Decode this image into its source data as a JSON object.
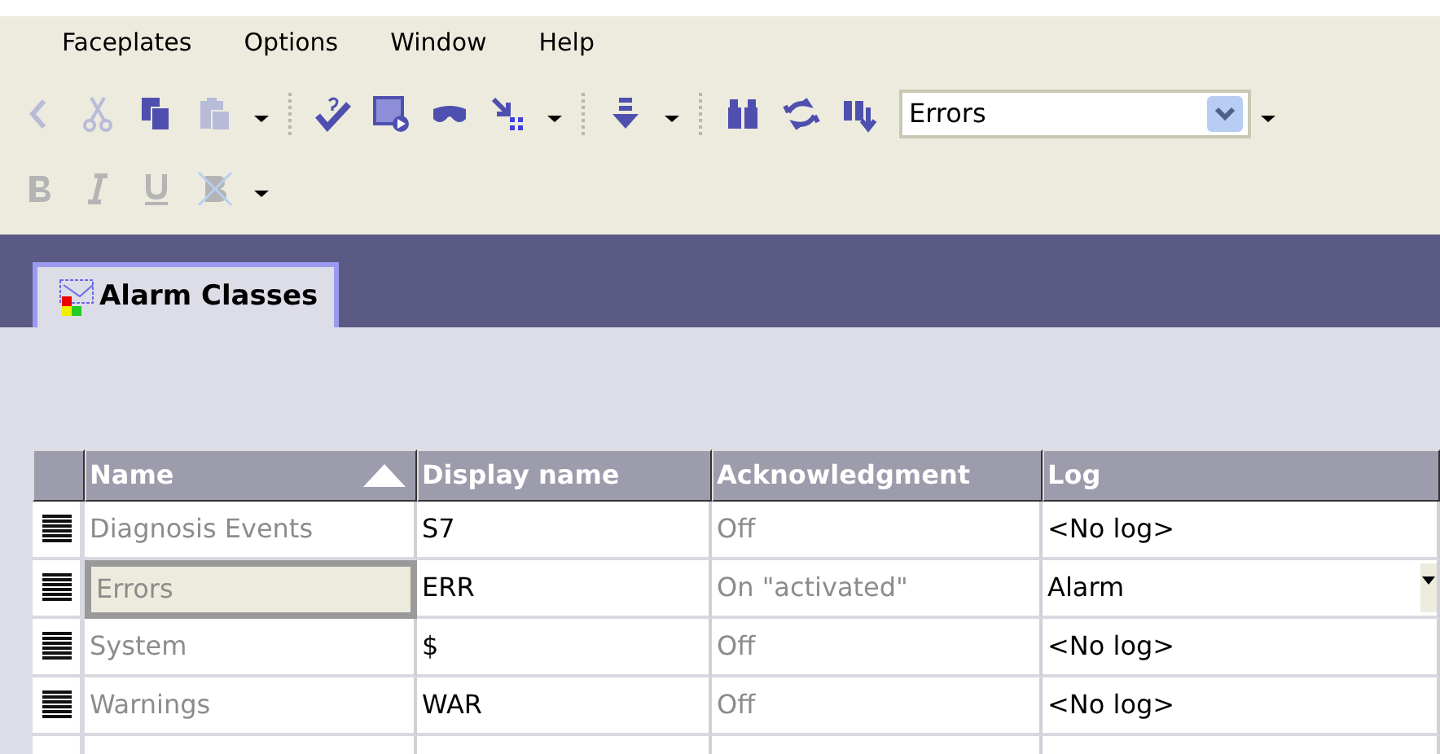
{
  "menu": [
    {
      "label": "Faceplates"
    },
    {
      "label": "Options"
    },
    {
      "label": "Window"
    },
    {
      "label": "Help"
    }
  ],
  "toolbar": [
    {
      "kind": "back",
      "disabled": true
    },
    {
      "kind": "cut",
      "disabled": true
    },
    {
      "kind": "copy",
      "disabled": false
    },
    {
      "kind": "paste",
      "disabled": true
    },
    {
      "kind": "caret",
      "disabled": false
    },
    {
      "kind": "separator"
    },
    {
      "kind": "check",
      "disabled": false
    },
    {
      "kind": "run",
      "disabled": false
    },
    {
      "kind": "glasses",
      "disabled": false
    },
    {
      "kind": "import",
      "disabled": false
    },
    {
      "kind": "caret",
      "disabled": false
    },
    {
      "kind": "separator"
    },
    {
      "kind": "download",
      "disabled": false
    },
    {
      "kind": "caret",
      "disabled": false
    },
    {
      "kind": "separator"
    },
    {
      "kind": "binoculars",
      "disabled": false
    },
    {
      "kind": "refresh",
      "disabled": false
    },
    {
      "kind": "find-next",
      "disabled": false
    },
    {
      "kind": "combo",
      "value": "Errors"
    },
    {
      "kind": "caret",
      "disabled": false
    }
  ],
  "format_toolbar": [
    {
      "kind": "bold",
      "disabled": true
    },
    {
      "kind": "italic",
      "disabled": true
    },
    {
      "kind": "underline",
      "disabled": true
    },
    {
      "kind": "strike",
      "disabled": true
    },
    {
      "kind": "caret",
      "disabled": false
    }
  ],
  "tabs": [
    {
      "label": "Alarm Classes",
      "selected": true
    }
  ],
  "table": {
    "columns": [
      {
        "label": "Name",
        "sorted_ascending": true
      },
      {
        "label": "Display name",
        "sorted_ascending": false
      },
      {
        "label": "Acknowledgment",
        "sorted_ascending": false
      },
      {
        "label": "Log",
        "sorted_ascending": false
      }
    ],
    "rows": [
      {
        "name": "Diagnosis Events",
        "display_name": "S7",
        "acknowledgment": "Off",
        "log": "<No log>",
        "selected": false
      },
      {
        "name": "Errors",
        "display_name": "ERR",
        "acknowledgment": "On \"activated\"",
        "log": "Alarm",
        "selected": true
      },
      {
        "name": "System",
        "display_name": "$",
        "acknowledgment": "Off",
        "log": "<No log>",
        "selected": false
      },
      {
        "name": "Warnings",
        "display_name": "WAR",
        "acknowledgment": "Off",
        "log": "<No log>",
        "selected": false
      }
    ]
  }
}
